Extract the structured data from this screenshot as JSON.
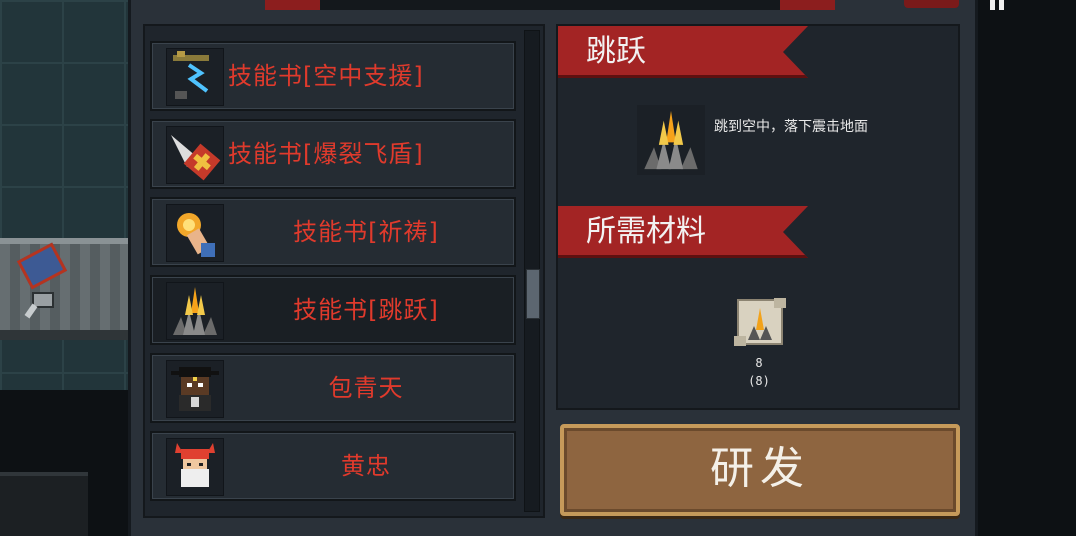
{
  "list": {
    "items": [
      {
        "label": "技能书[空中支援]",
        "icon": "airstrike-icon"
      },
      {
        "label": "技能书[爆裂飞盾]",
        "icon": "shield-icon"
      },
      {
        "label": "技能书[祈祷]",
        "icon": "pray-icon"
      },
      {
        "label": "技能书[跳跃]",
        "icon": "jump-icon"
      },
      {
        "label": "包青天",
        "icon": "character-bao-icon"
      },
      {
        "label": "黄忠",
        "icon": "character-huang-icon"
      }
    ],
    "selected_index": 3
  },
  "detail": {
    "skill_title": "跳跃",
    "skill_desc": "跳到空中，落下震击地面",
    "materials_title": "所需材料",
    "material": {
      "icon": "scroll-icon",
      "count": "8",
      "owned": "(8)"
    }
  },
  "actions": {
    "research_label": "研发"
  },
  "colors": {
    "accent_red": "#a32424",
    "label_red": "#e03a2c",
    "button_brown": "#8e6540"
  }
}
